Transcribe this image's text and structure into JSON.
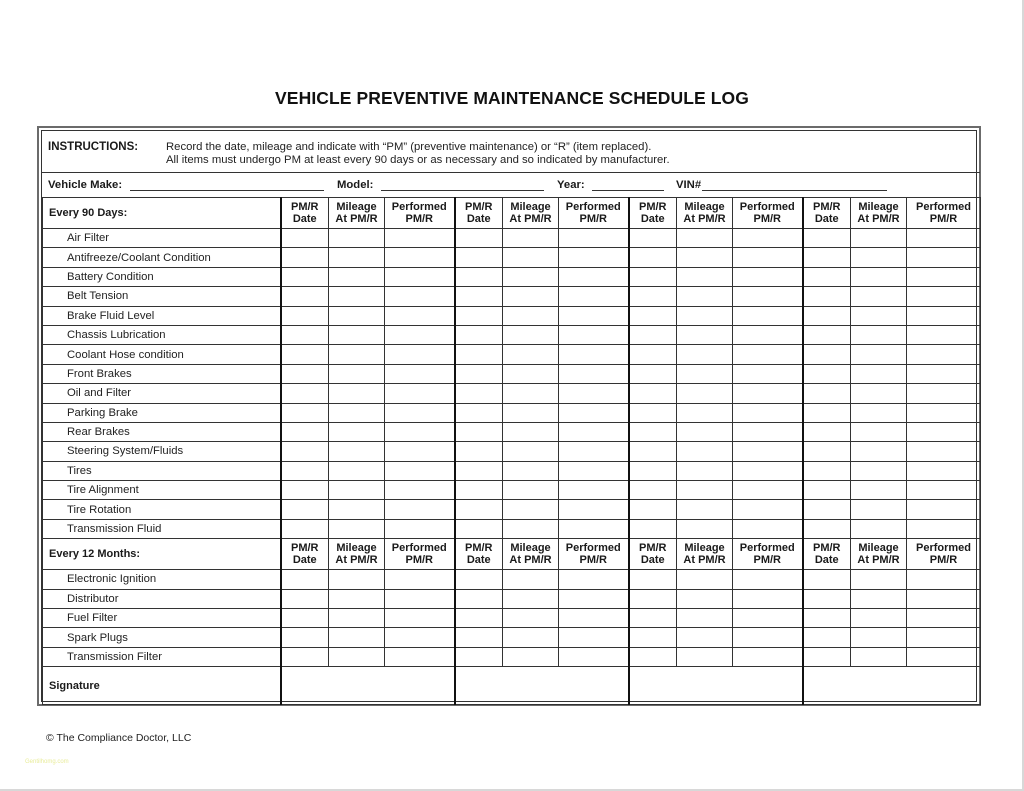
{
  "title": "VEHICLE PREVENTIVE MAINTENANCE SCHEDULE LOG",
  "instructions": {
    "label": "INSTRUCTIONS:",
    "line1": "Record the date, mileage and indicate with “PM” (preventive maintenance) or “R” (item replaced).",
    "line2": "All items must undergo PM at least every 90 days or as necessary and so indicated by manufacturer."
  },
  "vehicle": {
    "make_label": "Vehicle Make:",
    "make_value": "",
    "model_label": "Model:",
    "model_value": "",
    "year_label": "Year:",
    "year_value": "",
    "vin_label": "VIN#",
    "vin_value": ""
  },
  "column_headers": [
    {
      "line1": "PM/R",
      "line2": "Date"
    },
    {
      "line1": "Mileage",
      "line2": "At PM/R"
    },
    {
      "line1": "Performed",
      "line2": "PM/R"
    }
  ],
  "column_groups": 4,
  "sections": [
    {
      "label": "Every 90 Days:",
      "items": [
        "Air Filter",
        "Antifreeze/Coolant Condition",
        "Battery Condition",
        "Belt Tension",
        "Brake Fluid Level",
        "Chassis Lubrication",
        "Coolant Hose condition",
        "Front Brakes",
        "Oil and Filter",
        "Parking Brake",
        "Rear Brakes",
        "Steering System/Fluids",
        "Tires",
        "Tire Alignment",
        "Tire Rotation",
        "Transmission Fluid"
      ]
    },
    {
      "label": "Every 12 Months:",
      "items": [
        "Electronic Ignition",
        "Distributor",
        "Fuel Filter",
        "Spark Plugs",
        "Transmission Filter"
      ]
    }
  ],
  "signature_label": "Signature",
  "footer": {
    "copyright": "© The Compliance Doctor, LLC",
    "watermark": "Gentilhomg.com"
  }
}
